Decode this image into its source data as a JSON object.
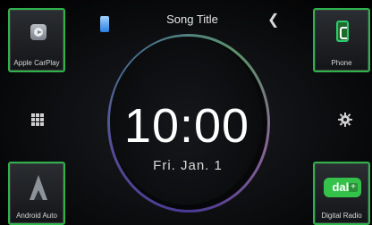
{
  "header": {
    "song_title": "Song Title"
  },
  "clock": {
    "time": "10:00",
    "date": "Fri.  Jan.  1"
  },
  "tiles": {
    "carplay": "Apple CarPlay",
    "phone": "Phone",
    "android_auto": "Android Auto",
    "digital_radio": "Digital Radio",
    "dab_logo": "dab"
  },
  "icons": {
    "menu": "grid-icon",
    "settings": "gear-icon",
    "back": "chevron-left-icon",
    "audio_source": "audio-indicator-icon"
  },
  "colors": {
    "tile_border": "#2fb24a",
    "dab_green": "#35c24a"
  }
}
